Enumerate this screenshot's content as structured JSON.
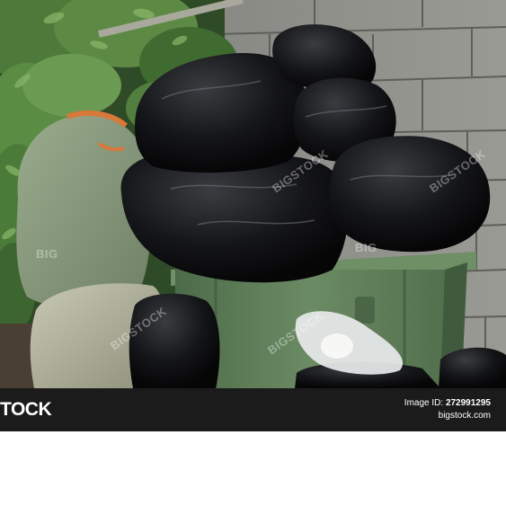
{
  "photo": {
    "subject": "garbage-bags-and-dumpster",
    "watermarks": [
      "BIGSTOCK",
      "BIGSTOCK",
      "BIGSTOCK",
      "BIG",
      "BIG",
      "BIGSTOCK"
    ]
  },
  "footer": {
    "brand": "TOCK",
    "image_label": "Image ID:",
    "image_id": "272991295",
    "site": "bigstock.com"
  },
  "colors": {
    "footer_bg": "#1b1b1b",
    "bin_green": "#5f7f5a",
    "bag_black": "#111214",
    "wall_gray": "#8a8a86",
    "foliage_green": "#4d7a3a"
  }
}
